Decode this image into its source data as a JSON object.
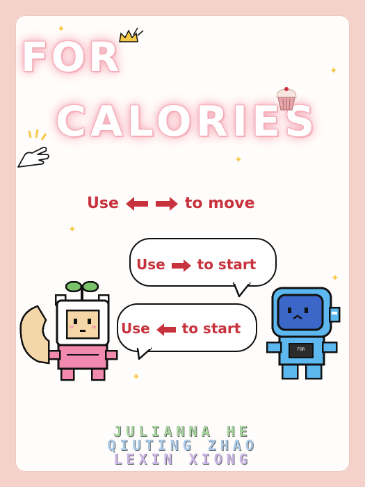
{
  "title": {
    "line1": "FOR",
    "line2": "CALORIES"
  },
  "instructions": {
    "move": {
      "prefix": "Use",
      "suffix": "to move"
    },
    "start_right": {
      "prefix": "Use",
      "suffix": "to start",
      "arrow": "right-arrow-icon"
    },
    "start_left": {
      "prefix": "Use",
      "suffix": "to start",
      "arrow": "left-arrow-icon"
    }
  },
  "characters": {
    "squirrel": {
      "icon": "sprout-squirrel-character"
    },
    "astronaut": {
      "icon": "blue-astronaut-character",
      "chest_label": "FOR"
    }
  },
  "credits": [
    "JULIANNA HE",
    "QIUTING ZHAO",
    "LEXIN XIONG"
  ],
  "colors": {
    "background": "#f4d2cb",
    "card": "#fffdfb",
    "accent": "#c8323d",
    "title_glow": "#f3aab6"
  }
}
